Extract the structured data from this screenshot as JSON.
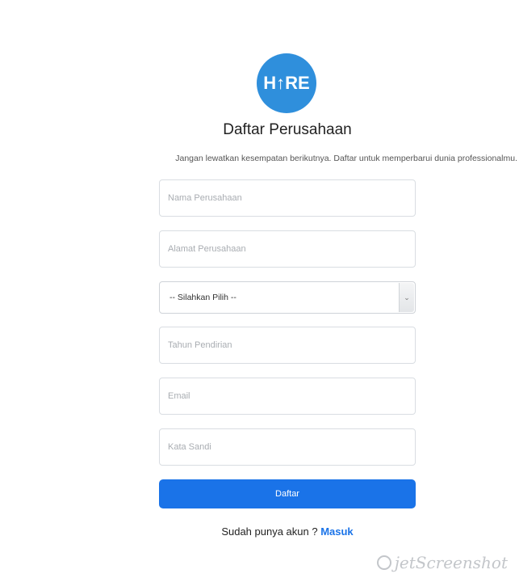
{
  "logo": {
    "text": "H↑RE",
    "color": "#2f8fdc"
  },
  "header": {
    "title": "Daftar Perusahaan",
    "subtitle": "Jangan lewatkan kesempatan berikutnya. Daftar untuk memperbarui dunia professionalmu."
  },
  "form": {
    "company_name": {
      "placeholder": "Nama Perusahaan",
      "value": ""
    },
    "company_address": {
      "placeholder": "Alamat Perusahaan",
      "value": ""
    },
    "category_select": {
      "selected": "-- Silahkan Pilih --"
    },
    "founded_year": {
      "placeholder": "Tahun Pendirian",
      "value": ""
    },
    "email": {
      "placeholder": "Email",
      "value": ""
    },
    "password": {
      "placeholder": "Kata Sandi",
      "value": ""
    },
    "submit_label": "Daftar"
  },
  "login": {
    "prompt": "Sudah punya akun ? ",
    "link_label": "Masuk"
  },
  "watermark": {
    "text": "jetScreenshot"
  },
  "colors": {
    "primary": "#1a73e8",
    "logo_bg": "#2f8fdc"
  }
}
